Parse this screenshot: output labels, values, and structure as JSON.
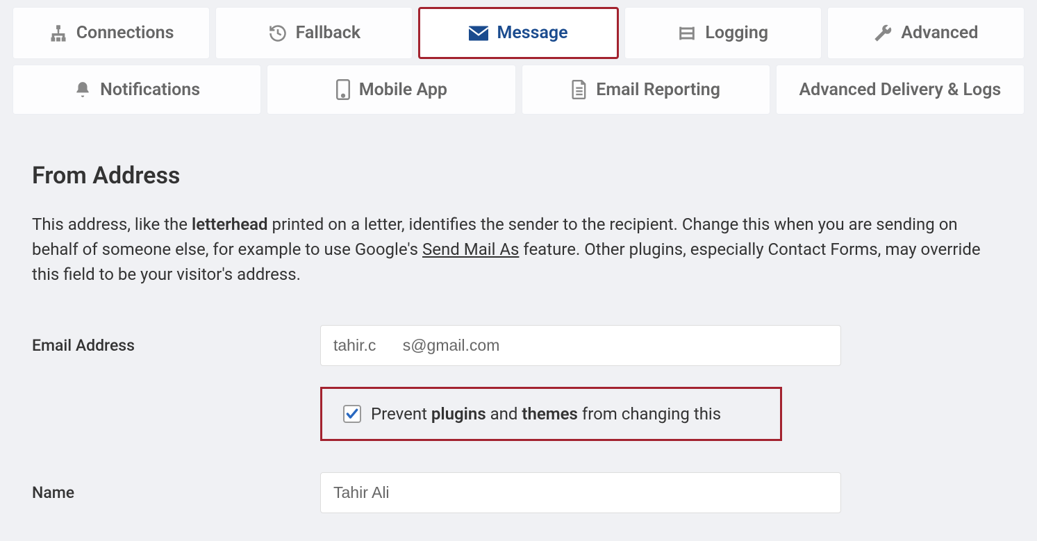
{
  "tabs_row1": [
    {
      "id": "connections",
      "label": "Connections",
      "icon": "sitemap"
    },
    {
      "id": "fallback",
      "label": "Fallback",
      "icon": "history"
    },
    {
      "id": "message",
      "label": "Message",
      "icon": "envelope",
      "active": true
    },
    {
      "id": "logging",
      "label": "Logging",
      "icon": "list"
    },
    {
      "id": "advanced",
      "label": "Advanced",
      "icon": "wrench"
    }
  ],
  "tabs_row2": [
    {
      "id": "notifications",
      "label": "Notifications",
      "icon": "bell"
    },
    {
      "id": "mobile-app",
      "label": "Mobile App",
      "icon": "mobile"
    },
    {
      "id": "email-reporting",
      "label": "Email Reporting",
      "icon": "file"
    },
    {
      "id": "advanced-delivery",
      "label": "Advanced Delivery & Logs",
      "icon": ""
    }
  ],
  "section": {
    "heading": "From Address",
    "desc_part1": "This address, like the ",
    "desc_bold1": "letterhead",
    "desc_part2": " printed on a letter, identifies the sender to the recipient. Change this when you are sending on behalf of someone else, for example to use Google's ",
    "desc_link": "Send Mail As",
    "desc_part3": " feature. Other plugins, especially Contact Forms, may override this field to be your visitor's address."
  },
  "form": {
    "email_label": "Email Address",
    "email_value": "tahir.c      s@gmail.com",
    "prevent_checkbox_checked": true,
    "prevent_label_part1": "Prevent ",
    "prevent_label_bold1": "plugins",
    "prevent_label_part2": " and ",
    "prevent_label_bold2": "themes",
    "prevent_label_part3": " from changing this",
    "name_label": "Name",
    "name_value": "Tahir Ali"
  }
}
